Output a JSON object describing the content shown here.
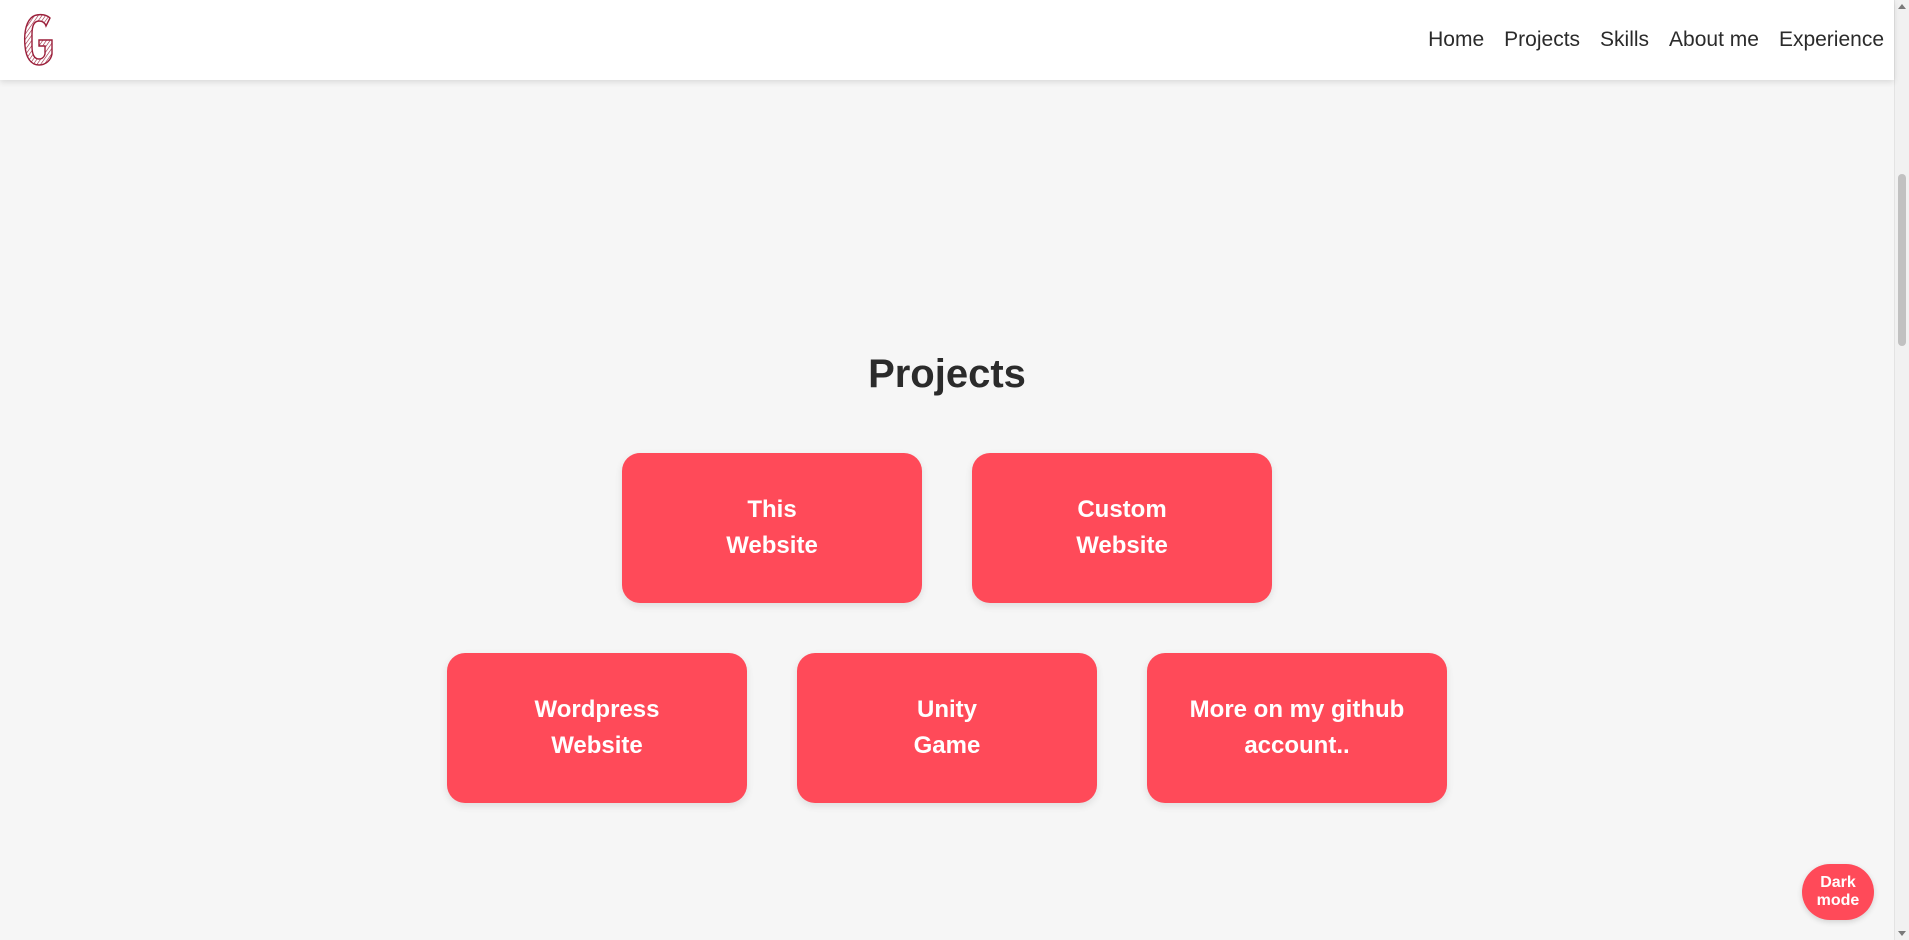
{
  "header": {
    "logo_icon": "G-logo-icon",
    "nav": [
      {
        "label": "Home"
      },
      {
        "label": "Projects"
      },
      {
        "label": "Skills"
      },
      {
        "label": "About me"
      },
      {
        "label": "Experience"
      }
    ]
  },
  "projects": {
    "title": "Projects",
    "cards": [
      {
        "label": "This\nWebsite"
      },
      {
        "label": "Custom\nWebsite"
      },
      {
        "label": "Wordpress\nWebsite"
      },
      {
        "label": "Unity\nGame"
      },
      {
        "label": "More on my github account.."
      }
    ]
  },
  "dark_mode": {
    "label": "Dark\nmode"
  },
  "colors": {
    "accent": "#ff4a59",
    "background": "#f6f6f6",
    "header_bg": "#ffffff",
    "text": "#2b2b2b",
    "logo": "#9b1f3a"
  }
}
